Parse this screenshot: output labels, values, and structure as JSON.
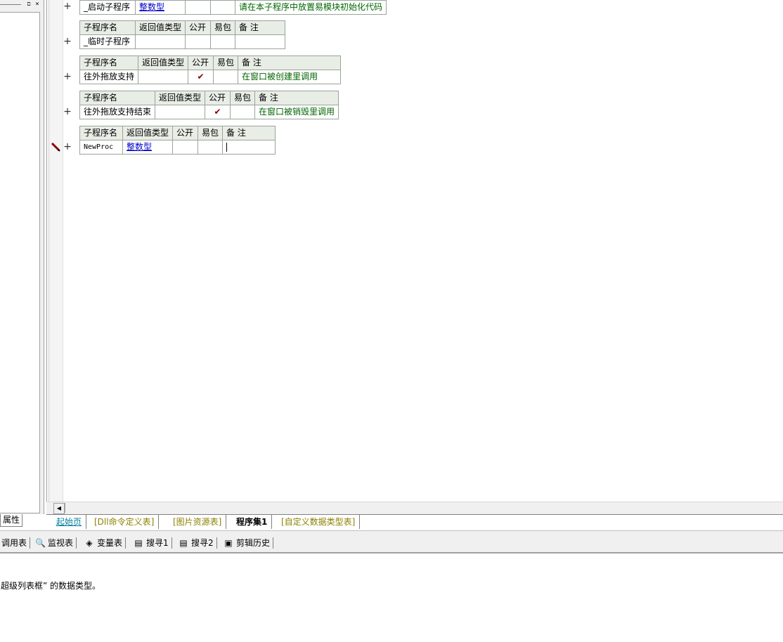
{
  "left_panel": {
    "tab_label": "属性",
    "pin_glyph": "ם",
    "close_glyph": "×"
  },
  "procedures": [
    {
      "headers": [
        "子程序名",
        "返回值类型",
        "公开",
        "易包",
        "备 注"
      ],
      "name": "_启动子程序",
      "return_type": "整数型",
      "public": "",
      "easy_pkg": "",
      "remark": "请在本子程序中放置易模块初始化代码",
      "header_visible": false
    },
    {
      "headers": [
        "子程序名",
        "返回值类型",
        "公开",
        "易包",
        "备 注"
      ],
      "name": "_临时子程序",
      "return_type": "",
      "public": "",
      "easy_pkg": "",
      "remark": ""
    },
    {
      "headers": [
        "子程序名",
        "返回值类型",
        "公开",
        "易包",
        "备 注"
      ],
      "name": "往外拖放支持",
      "return_type": "",
      "public": "✔",
      "easy_pkg": "",
      "remark": "在窗口被创建里调用"
    },
    {
      "headers": [
        "子程序名",
        "返回值类型",
        "公开",
        "易包",
        "备 注"
      ],
      "name": "往外拖放支持结束",
      "return_type": "",
      "public": "✔",
      "easy_pkg": "",
      "remark": "在窗口被销毁里调用"
    },
    {
      "headers": [
        "子程序名",
        "返回值类型",
        "公开",
        "易包",
        "备 注"
      ],
      "name": "NewProc",
      "return_type": "整数型",
      "public": "",
      "easy_pkg": "",
      "remark": ""
    }
  ],
  "gutter": {
    "expand_glyph": "+",
    "edit_icon": "pencil-icon"
  },
  "tabs": [
    {
      "label": "起始页"
    },
    {
      "label": "[Dll命令定义表]"
    },
    {
      "label": "[图片资源表]"
    },
    {
      "label": "程序集1"
    },
    {
      "label": "[自定义数据类型表]"
    }
  ],
  "bottom_toolbar": [
    {
      "label": "调用表",
      "icon": ""
    },
    {
      "label": "监视表",
      "icon": "🔍"
    },
    {
      "label": "变量表",
      "icon": "◈"
    },
    {
      "label": "搜寻1",
      "icon": "▤"
    },
    {
      "label": "搜寻2",
      "icon": "▤"
    },
    {
      "label": "剪辑历史",
      "icon": "▣"
    }
  ],
  "output": {
    "message": "超级列表框” 的数据类型。"
  }
}
